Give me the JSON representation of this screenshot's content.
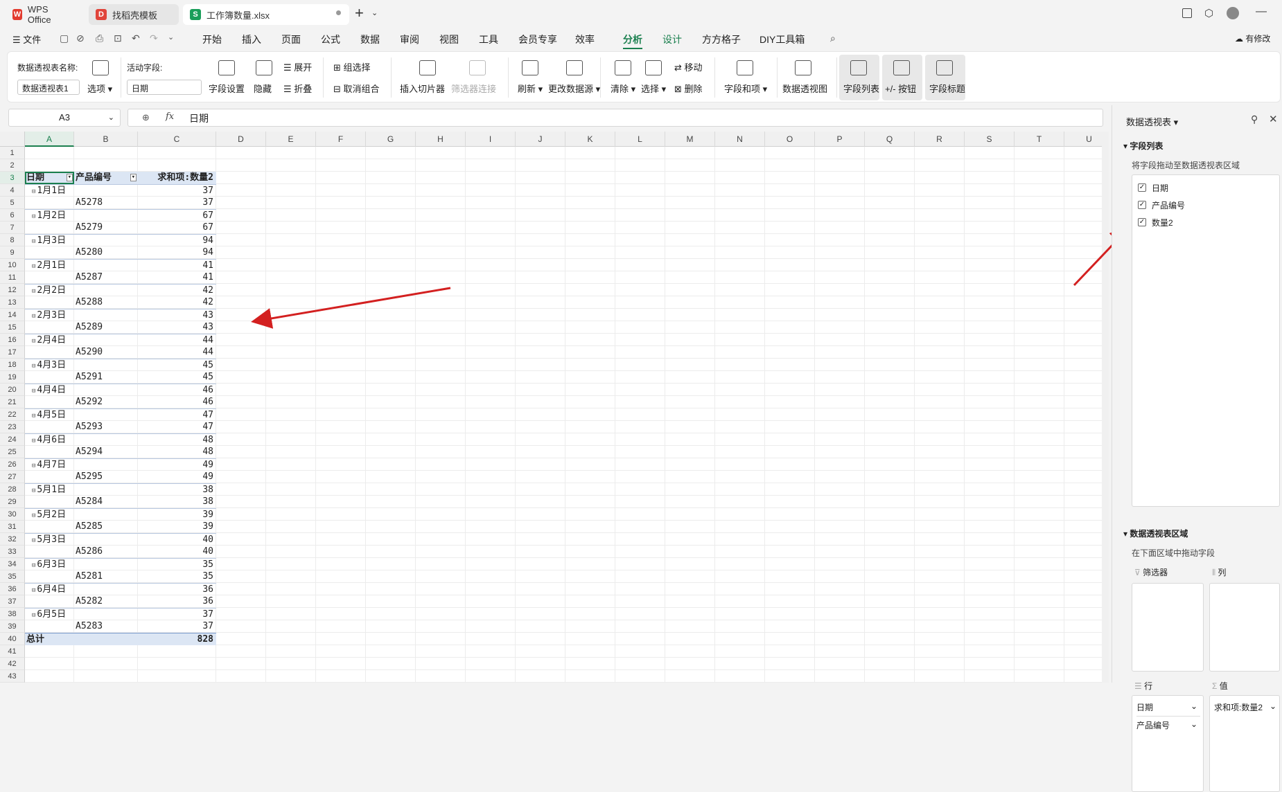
{
  "titlebar": {
    "tabs": [
      {
        "label": "WPS Office",
        "icon": "wps-logo"
      },
      {
        "label": "找稻壳模板",
        "icon": "docer-logo"
      },
      {
        "label": "工作簿数量.xlsx",
        "icon": "spreadsheet-logo"
      }
    ]
  },
  "menu": {
    "file": "文件",
    "tabs": [
      "开始",
      "插入",
      "页面",
      "公式",
      "数据",
      "审阅",
      "视图",
      "工具",
      "会员专享",
      "效率",
      "分析",
      "设计",
      "方方格子",
      "DIY工具箱"
    ],
    "active": "分析",
    "has_changes": "有修改"
  },
  "ribbon": {
    "pivot_name_label": "数据透视表名称:",
    "pivot_name_value": "数据透视表1",
    "options": "选项",
    "active_field_label": "活动字段:",
    "active_field_value": "日期",
    "field_settings": "字段设置",
    "hide": "隐藏",
    "expand": "展开",
    "collapse": "折叠",
    "group_select": "组选择",
    "ungroup": "取消组合",
    "insert_slicer": "插入切片器",
    "filter_connection": "筛选器连接",
    "refresh": "刷新",
    "change_source": "更改数据源",
    "clear": "清除",
    "select": "选择",
    "move": "移动",
    "delete": "删除",
    "fields_items": "字段和项",
    "pivot_chart": "数据透视图",
    "field_list": "字段列表",
    "plus_minus": "+/- 按钮",
    "field_headers": "字段标题"
  },
  "formula": {
    "cell_ref": "A3",
    "fx": "fx",
    "content": "日期"
  },
  "sheet": {
    "columns": [
      "A",
      "B",
      "C",
      "D",
      "E",
      "F",
      "G",
      "H",
      "I",
      "J",
      "K",
      "L",
      "M",
      "N",
      "O",
      "P",
      "Q",
      "R",
      "S",
      "T",
      "U"
    ],
    "header": {
      "a": "日期",
      "b": "产品编号",
      "c": "求和项:数量2"
    },
    "groups": [
      {
        "date": "1月1日",
        "code": "A5278",
        "value": "37"
      },
      {
        "date": "1月2日",
        "code": "A5279",
        "value": "67"
      },
      {
        "date": "1月3日",
        "code": "A5280",
        "value": "94"
      },
      {
        "date": "2月1日",
        "code": "A5287",
        "value": "41"
      },
      {
        "date": "2月2日",
        "code": "A5288",
        "value": "42"
      },
      {
        "date": "2月3日",
        "code": "A5289",
        "value": "43"
      },
      {
        "date": "2月4日",
        "code": "A5290",
        "value": "44"
      },
      {
        "date": "4月3日",
        "code": "A5291",
        "value": "45"
      },
      {
        "date": "4月4日",
        "code": "A5292",
        "value": "46"
      },
      {
        "date": "4月5日",
        "code": "A5293",
        "value": "47"
      },
      {
        "date": "4月6日",
        "code": "A5294",
        "value": "48"
      },
      {
        "date": "4月7日",
        "code": "A5295",
        "value": "49"
      },
      {
        "date": "5月1日",
        "code": "A5284",
        "value": "38"
      },
      {
        "date": "5月2日",
        "code": "A5285",
        "value": "39"
      },
      {
        "date": "5月3日",
        "code": "A5286",
        "value": "40"
      },
      {
        "date": "6月3日",
        "code": "A5281",
        "value": "35"
      },
      {
        "date": "6月4日",
        "code": "A5282",
        "value": "36"
      },
      {
        "date": "6月5日",
        "code": "A5283",
        "value": "37"
      }
    ],
    "total_label": "总计",
    "total_value": "828"
  },
  "panel": {
    "title": "数据透视表",
    "field_list_heading": "字段列表",
    "drag_hint": "将字段拖动至数据透视表区域",
    "fields": [
      {
        "label": "日期",
        "checked": true
      },
      {
        "label": "产品编号",
        "checked": true
      },
      {
        "label": "数量2",
        "checked": true
      }
    ],
    "areas_heading": "数据透视表区域",
    "areas_hint": "在下面区域中拖动字段",
    "filter_label": "筛选器",
    "column_label": "列",
    "row_label": "行",
    "value_label": "值",
    "row_items": [
      "日期",
      "产品编号"
    ],
    "value_items": [
      "求和项:数量2"
    ]
  },
  "colors": {
    "accent": "#1a7f4e",
    "header_fill": "#dce6f4",
    "arrow": "#d32020"
  }
}
